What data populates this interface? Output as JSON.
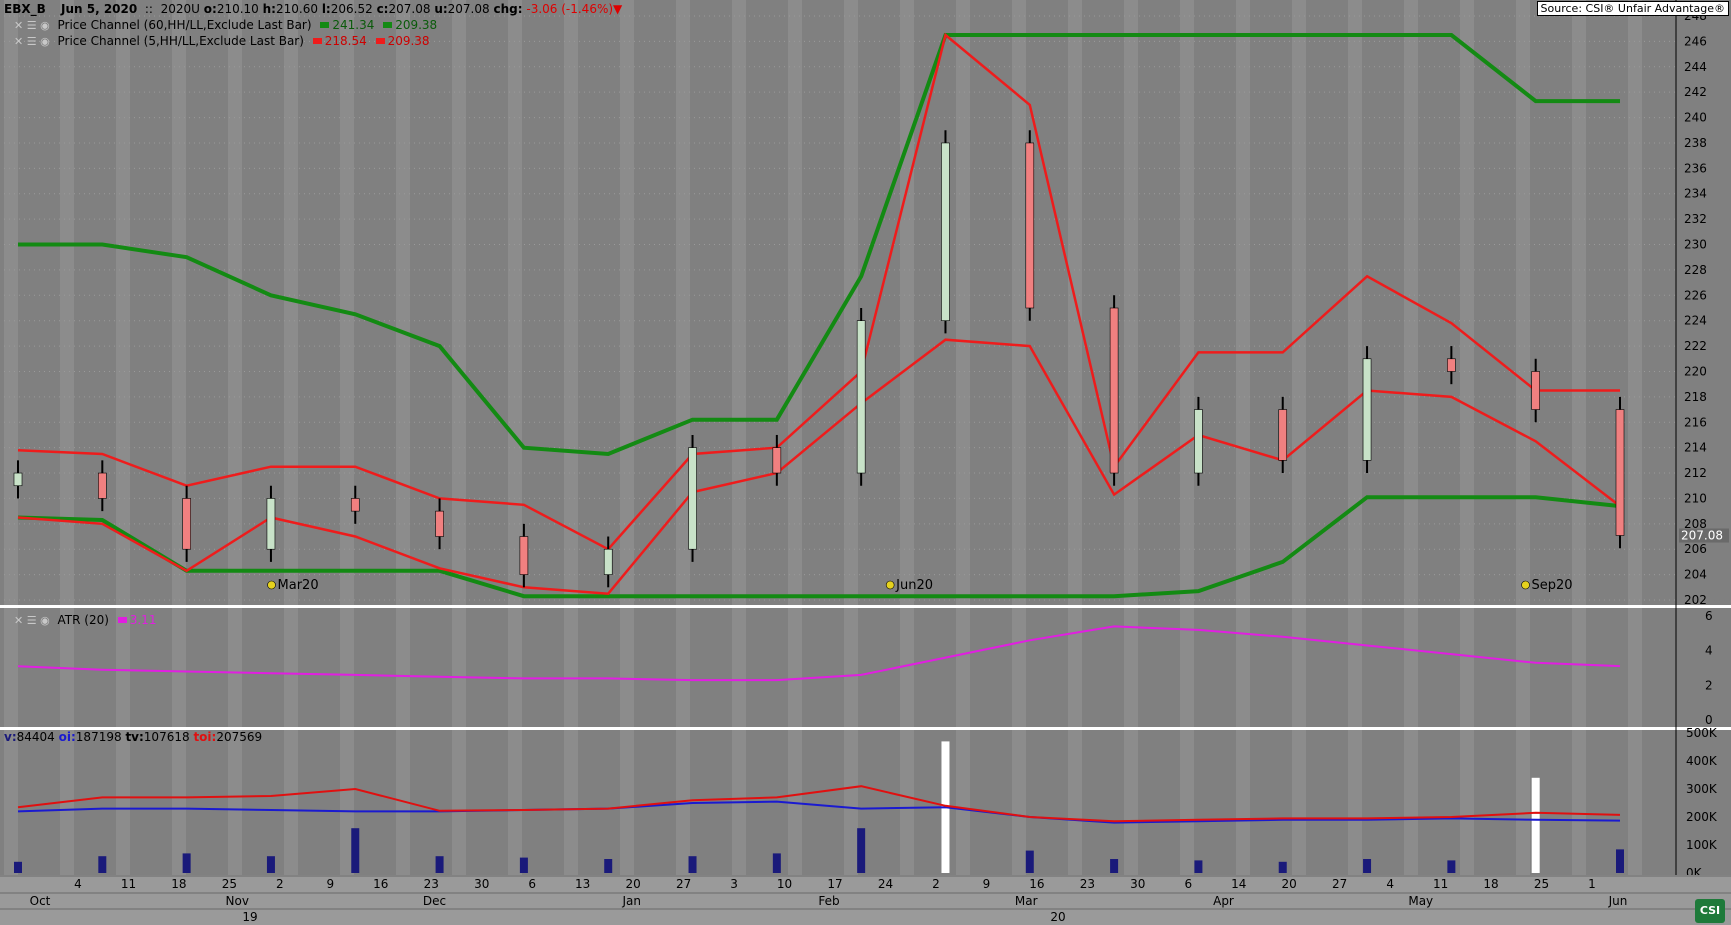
{
  "header": {
    "symbol": "EBX_B",
    "date": "Jun  5, 2020",
    "sep": "::",
    "contract": "2020U",
    "o_label": "o:",
    "o": "210.10",
    "h_label": "h:",
    "h": "210.60",
    "l_label": "l:",
    "l": "206.52",
    "c_label": "c:",
    "c": "207.08",
    "u_label": "u:",
    "u": "207.08",
    "chg_label": "chg:",
    "chg": "-3.06 (-1.46%)"
  },
  "source": "Source: CSI® Unfair Advantage®",
  "indicators": {
    "pc60": {
      "label": "Price Channel (60,HH/LL,Exclude Last Bar)",
      "upper": "241.34",
      "lower": "209.38",
      "color": "#138a13"
    },
    "pc5": {
      "label": "Price Channel (5,HH/LL,Exclude Last Bar)",
      "upper": "218.54",
      "lower": "209.38",
      "color": "#ee1c1c"
    },
    "atr": {
      "label": "ATR (20)",
      "value": "3.11",
      "color": "#e11ee1"
    },
    "vol": {
      "v_label": "v:",
      "v": "84404",
      "oi_label": "oi:",
      "oi": "187198",
      "tv_label": "tv:",
      "tv": "107618",
      "toi_label": "toi:",
      "toi": "207569"
    }
  },
  "price_box": "207.08",
  "markers": [
    "Mar20",
    "Jun20",
    "Sep20"
  ],
  "colors": {
    "background": "#808080",
    "band_light": "#8c8c8c",
    "up_candle": "#c8e2c8",
    "down_candle": "#f08080",
    "volume_bar": "#1a1a7a",
    "volume_bar_highlight": "#ffffff",
    "oi_line": "#1a1ad0",
    "toi_line": "#e01010",
    "marker": "#e6d21e"
  },
  "x_axis": {
    "days": [
      "4",
      "11",
      "18",
      "25",
      "2",
      "9",
      "16",
      "23",
      "30",
      "6",
      "13",
      "20",
      "27",
      "3",
      "10",
      "17",
      "24",
      "2",
      "9",
      "16",
      "23",
      "30",
      "6",
      "14",
      "20",
      "27",
      "4",
      "11",
      "18",
      "25",
      "1"
    ],
    "months": [
      "Oct",
      "Nov",
      "Dec",
      "Jan",
      "Feb",
      "Mar",
      "Apr",
      "May",
      "Jun"
    ],
    "years": [
      "19",
      "20"
    ]
  },
  "chart_data": [
    {
      "type": "candlestick",
      "title": "",
      "ylim": [
        202,
        248
      ],
      "ytick_labels": [
        "248",
        "246",
        "244",
        "242",
        "240",
        "238",
        "236",
        "234",
        "232",
        "230",
        "228",
        "226",
        "224",
        "222",
        "220",
        "218",
        "216",
        "214",
        "212",
        "210",
        "208",
        "206",
        "204",
        "202"
      ],
      "series": [
        {
          "name": "Close",
          "x": [
            "2019-10-01",
            "2019-10-15",
            "2019-11-01",
            "2019-11-15",
            "2019-12-02",
            "2019-12-16",
            "2020-01-02",
            "2020-01-15",
            "2020-02-03",
            "2020-02-18",
            "2020-03-02",
            "2020-03-09",
            "2020-03-16",
            "2020-03-23",
            "2020-04-01",
            "2020-04-15",
            "2020-05-01",
            "2020-05-15",
            "2020-06-01",
            "2020-06-05"
          ],
          "values": [
            212,
            210,
            206,
            210,
            209,
            207,
            204,
            206,
            214,
            212,
            224,
            238,
            225,
            212,
            217,
            213,
            221,
            220,
            217,
            207.08
          ]
        },
        {
          "name": "Price Channel (60,HH/LL,Exclude Last Bar)",
          "upper": [
            230,
            230,
            229,
            226,
            224.5,
            222,
            214,
            213.5,
            216.2,
            216.2,
            227.5,
            246.5,
            246.5,
            246.5,
            246.5,
            246.5,
            246.5,
            246.5,
            241.3,
            241.3
          ],
          "lower": [
            208.5,
            208.3,
            204.3,
            204.3,
            204.3,
            204.3,
            202.3,
            202.3,
            202.3,
            202.3,
            202.3,
            202.3,
            202.3,
            202.3,
            202.7,
            205,
            210.1,
            210.1,
            210.1,
            209.4
          ]
        },
        {
          "name": "Price Channel (5,HH/LL,Exclude Last Bar)",
          "upper": [
            213.8,
            213.5,
            211,
            212.5,
            212.5,
            210,
            209.5,
            206,
            213.5,
            214,
            220,
            246.5,
            241,
            212.5,
            221.5,
            221.5,
            227.5,
            223.8,
            218.5,
            218.5
          ],
          "lower": [
            208.5,
            208,
            204.3,
            208.5,
            207,
            204.5,
            203,
            202.5,
            210.5,
            212,
            217.5,
            222.5,
            222,
            210.3,
            215,
            213,
            218.5,
            218,
            214.5,
            209.4
          ]
        }
      ]
    },
    {
      "type": "line",
      "title": "",
      "ylim": [
        0,
        6
      ],
      "ytick_labels": [
        "6",
        "4",
        "2",
        "0"
      ],
      "series": [
        {
          "name": "ATR (20)",
          "values": [
            3.1,
            2.9,
            2.8,
            2.7,
            2.6,
            2.5,
            2.4,
            2.4,
            2.3,
            2.3,
            2.6,
            3.6,
            4.6,
            5.4,
            5.2,
            4.8,
            4.3,
            3.8,
            3.3,
            3.11
          ]
        }
      ]
    },
    {
      "type": "bar",
      "title": "",
      "ylim": [
        0,
        500000
      ],
      "ytick_labels": [
        "500K",
        "400K",
        "300K",
        "200K",
        "100K",
        "0K"
      ],
      "series": [
        {
          "name": "v",
          "values": [
            40000,
            60000,
            70000,
            60000,
            160000,
            60000,
            55000,
            50000,
            60000,
            70000,
            160000,
            470000,
            80000,
            50000,
            45000,
            40000,
            50000,
            45000,
            340000,
            84404
          ]
        },
        {
          "name": "oi",
          "values": [
            220000,
            230000,
            230000,
            225000,
            220000,
            220000,
            225000,
            230000,
            250000,
            255000,
            230000,
            235000,
            200000,
            180000,
            185000,
            190000,
            190000,
            195000,
            190000,
            187198
          ]
        },
        {
          "name": "toi",
          "values": [
            235000,
            270000,
            270000,
            275000,
            300000,
            222000,
            225000,
            230000,
            260000,
            270000,
            310000,
            240000,
            200000,
            185000,
            190000,
            195000,
            195000,
            200000,
            215000,
            207569
          ]
        }
      ]
    }
  ]
}
